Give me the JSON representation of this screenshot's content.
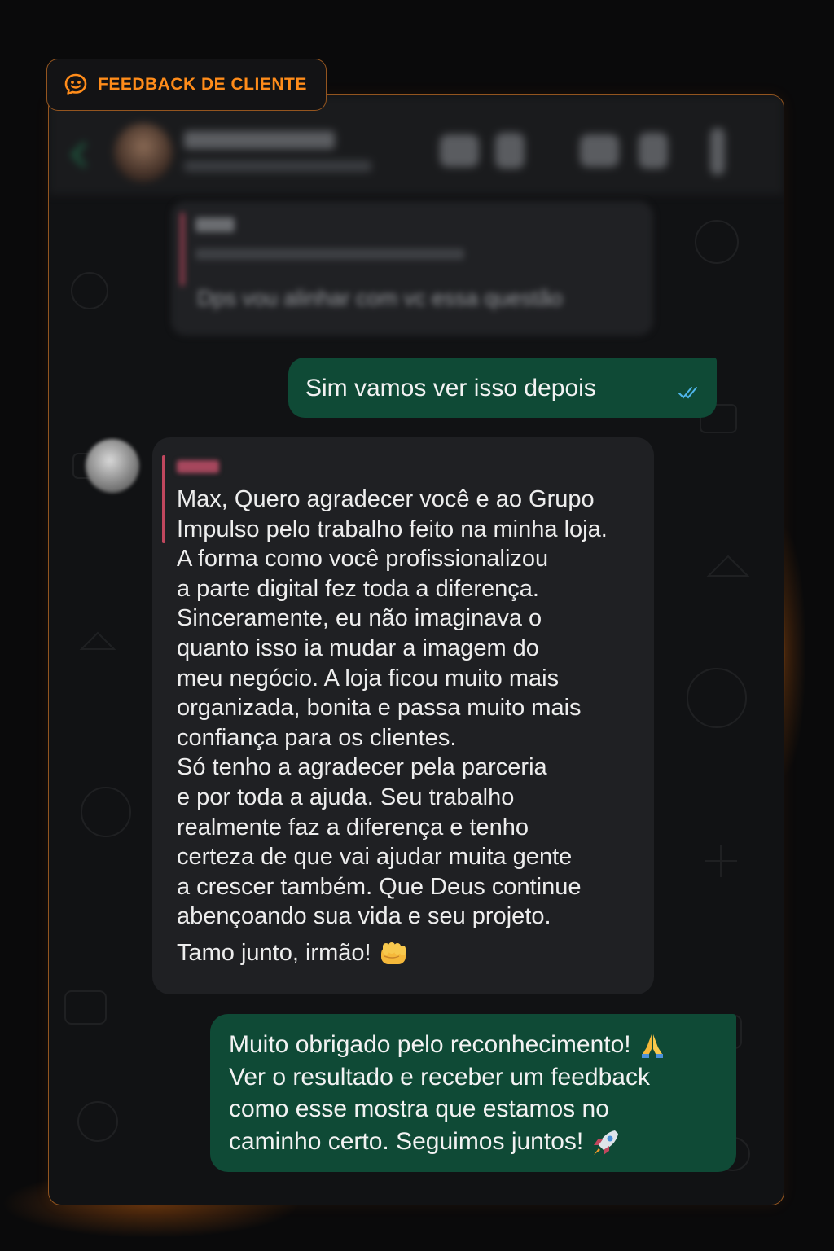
{
  "badge": {
    "label": "FEEDBACK DE CLIENTE",
    "icon": "chat-bubble-smile-icon",
    "accent": "#ff8c1a"
  },
  "header": {
    "back_icon": "back-arrow-icon",
    "actions": [
      "video-call-icon",
      "phone-call-icon",
      "more-options-icon"
    ]
  },
  "messages": {
    "blurred_incoming": {
      "text": "Dps vou alinhar com vc essa questão"
    },
    "outgoing_1": {
      "text": "Sim vamos ver isso depois",
      "status_icon": "double-check-icon"
    },
    "incoming_main": {
      "lines": [
        "Max, Quero agradecer você e ao Grupo",
        "Impulso pelo trabalho feito na minha loja.",
        "A forma como você profissionalizou",
        "a parte digital fez toda a diferença.",
        "Sinceramente, eu não imaginava o",
        "quanto isso ia mudar a imagem do",
        "meu negócio. A loja ficou muito mais",
        "organizada, bonita e passa muito mais",
        "confiança para os clientes.",
        "Só tenho a agradecer pela parceria",
        "e por toda a ajuda. Seu trabalho",
        "realmente faz a diferença e tenho",
        "certeza de que vai ajudar muita gente",
        "a crescer também. Que Deus continue",
        "abençoando sua vida e seu projeto."
      ],
      "signoff": "Tamo junto, irmão!",
      "signoff_emoji": "fist-emoji"
    },
    "outgoing_2": {
      "lines": [
        "Muito obrigado pelo reconhecimento!",
        "Ver o resultado e receber um feedback",
        "como esse mostra que estamos no",
        "caminho certo. Seguimos juntos!"
      ],
      "line1_emoji": "praying-hands-emoji",
      "line4_emoji": "rocket-emoji"
    }
  },
  "colors": {
    "outgoing_bubble": "#0f4a36",
    "incoming_bubble": "#1f2023",
    "frame_border": "#ff8c28",
    "reply_bar": "#c0475e"
  }
}
